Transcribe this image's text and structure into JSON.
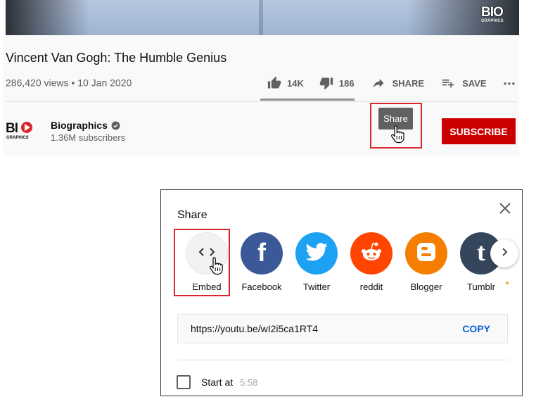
{
  "video": {
    "title": "Vincent Van Gogh: The Humble Genius",
    "views": "286,420 views",
    "separator": "•",
    "date": "10 Jan 2020",
    "logo_text": "BIO",
    "logo_subtext": "GRAPHICS"
  },
  "actions": {
    "likes": "14K",
    "dislikes": "186",
    "share": "SHARE",
    "save": "SAVE"
  },
  "channel": {
    "name": "Biographics",
    "subscribers": "1.36M subscribers",
    "logo_text": "BIO",
    "logo_subtext": "GRAPHICS",
    "subscribe_label": "SUBSCRIBE",
    "verified_icon": "check-circle-icon"
  },
  "tooltip": {
    "share": "Share"
  },
  "share_dialog": {
    "title": "Share",
    "targets": [
      {
        "label": "Embed",
        "icon": "code-icon",
        "color": "#f2f2f2"
      },
      {
        "label": "Facebook",
        "icon": "facebook-icon",
        "color": "#3b5998"
      },
      {
        "label": "Twitter",
        "icon": "twitter-icon",
        "color": "#1da1f2"
      },
      {
        "label": "reddit",
        "icon": "reddit-icon",
        "color": "#ff4500"
      },
      {
        "label": "Blogger",
        "icon": "blogger-icon",
        "color": "#f57d00"
      },
      {
        "label": "Tumblr",
        "icon": "tumblr-icon",
        "color": "#35465c"
      }
    ],
    "url": "https://youtu.be/wI2i5ca1RT4",
    "copy_label": "COPY",
    "start_at_label": "Start at",
    "start_at_time": "5:58"
  },
  "colors": {
    "subscribe": "#cc0000",
    "highlight": "#d9262c",
    "link": "#065fd4"
  }
}
